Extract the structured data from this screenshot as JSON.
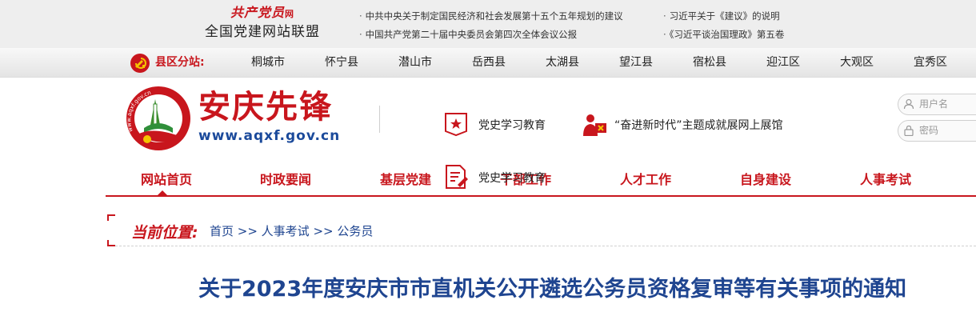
{
  "top_bar": {
    "brand_cursive": "共产党员",
    "brand_cursive_suffix": "网",
    "brand_name": "全国党建网站联盟",
    "news_links": [
      "中共中央关于制定国民经济和社会发展第十五个五年规划的建议",
      "习近平关于《建议》的说明",
      "中国共产党第二十届中央委员会第四次全体会议公报",
      "《习近平谈治国理政》第五卷"
    ]
  },
  "county_bar": {
    "label": "县区分站:",
    "counties": [
      "桐城市",
      "怀宁县",
      "潜山市",
      "岳西县",
      "太湖县",
      "望江县",
      "宿松县",
      "迎江区",
      "大观区",
      "宜秀区"
    ]
  },
  "header": {
    "logo_title": "安庆先锋",
    "logo_url": "www.aqxf.gov.cn",
    "logo_ring_text": "www.aqxf.gov.cn",
    "features": [
      {
        "label": "党史学习教育",
        "icon": "party-history-book-icon"
      },
      {
        "label": "“奋进新时代”主题成就展网上展馆",
        "icon": "exhibition-flag-icon"
      },
      {
        "label": "党史学习教育",
        "icon": "document-edit-icon"
      }
    ],
    "login": {
      "username_placeholder": "用户名",
      "password_placeholder": "密码"
    }
  },
  "nav": {
    "items": [
      "网站首页",
      "时政要闻",
      "基层党建",
      "干部工作",
      "人才工作",
      "自身建设",
      "人事考试"
    ],
    "active_index": 0
  },
  "breadcrumb": {
    "label": "当前位置:",
    "path": "首页 >> 人事考试 >> 公务员"
  },
  "article": {
    "title": "关于2023年度安庆市市直机关公开遴选公务员资格复审等有关事项的通知"
  },
  "colors": {
    "party_red": "#c8161d",
    "link_blue": "#1f4590",
    "url_blue": "#1b4a9b"
  }
}
